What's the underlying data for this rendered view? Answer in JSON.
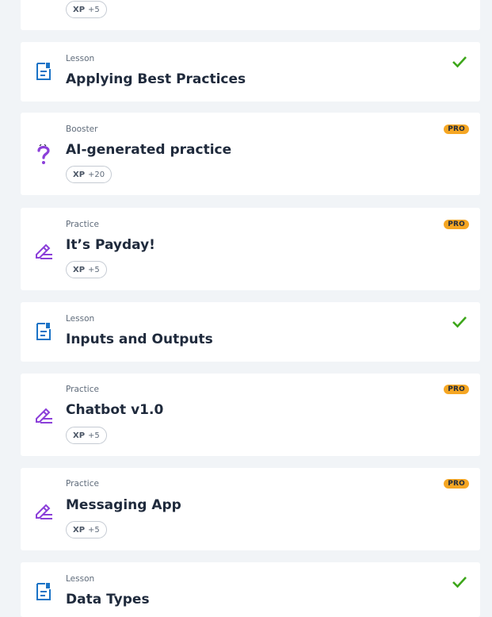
{
  "items": [
    {
      "type": "",
      "title": "",
      "xp_label": "XP",
      "xp_value": "+5",
      "pro": "",
      "completed": false,
      "icon": "none"
    },
    {
      "type": "Lesson",
      "title": "Applying Best Practices",
      "xp_label": "",
      "xp_value": "",
      "pro": "",
      "completed": true,
      "icon": "lesson-icon"
    },
    {
      "type": "Booster",
      "title": "AI-generated practice",
      "xp_label": "XP",
      "xp_value": "+20",
      "pro": "PRO",
      "completed": false,
      "icon": "question-icon"
    },
    {
      "type": "Practice",
      "title": "It’s Payday!",
      "xp_label": "XP",
      "xp_value": "+5",
      "pro": "PRO",
      "completed": false,
      "icon": "pencil-icon"
    },
    {
      "type": "Lesson",
      "title": "Inputs and Outputs",
      "xp_label": "",
      "xp_value": "",
      "pro": "",
      "completed": true,
      "icon": "lesson-icon"
    },
    {
      "type": "Practice",
      "title": "Chatbot v1.0",
      "xp_label": "XP",
      "xp_value": "+5",
      "pro": "PRO",
      "completed": false,
      "icon": "pencil-icon"
    },
    {
      "type": "Practice",
      "title": "Messaging App",
      "xp_label": "XP",
      "xp_value": "+5",
      "pro": "PRO",
      "completed": false,
      "icon": "pencil-icon"
    },
    {
      "type": "Lesson",
      "title": "Data Types",
      "xp_label": "",
      "xp_value": "",
      "pro": "",
      "completed": true,
      "icon": "lesson-icon"
    }
  ],
  "colors": {
    "background": "#f1f4f7",
    "card": "#ffffff",
    "lesson_icon": "#1a73c6",
    "practice_icon": "#8b3fd9",
    "check": "#3ca619",
    "pro_badge": "#f5a623"
  }
}
